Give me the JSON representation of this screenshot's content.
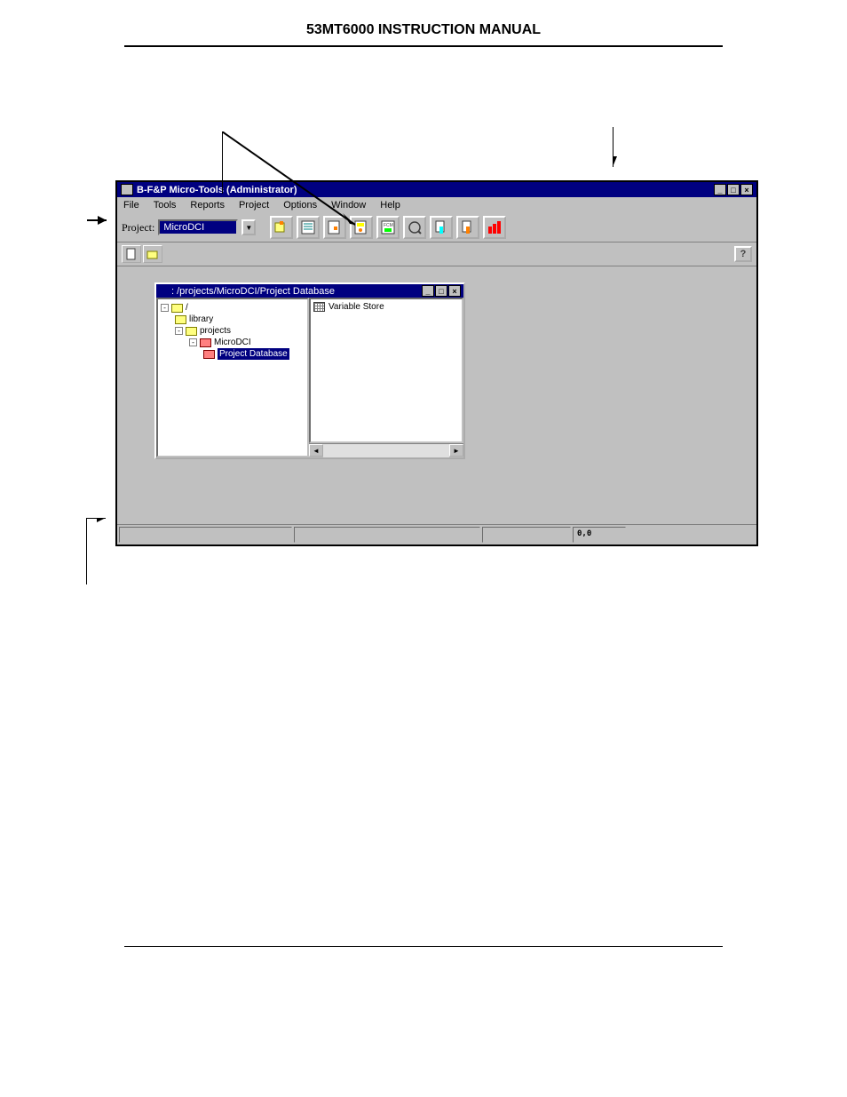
{
  "page": {
    "header": "53MT6000 INSTRUCTION MANUAL"
  },
  "window": {
    "title": "B-F&P Micro-Tools (Administrator)"
  },
  "menus": {
    "file": "File",
    "tools": "Tools",
    "reports": "Reports",
    "project": "Project",
    "options": "Options",
    "window": "Window",
    "help": "Help"
  },
  "toolbar": {
    "project_label": "Project:",
    "project_value": "MicroDCI"
  },
  "child_window": {
    "title": ": /projects/MicroDCI/Project Database"
  },
  "tree": {
    "root": "/",
    "library": "library",
    "projects": "projects",
    "microdci": "MicroDCI",
    "project_database": "Project Database"
  },
  "list": {
    "variable_store": "Variable Store"
  },
  "statusbar": {
    "coords": "0,0"
  },
  "help_button": "?"
}
